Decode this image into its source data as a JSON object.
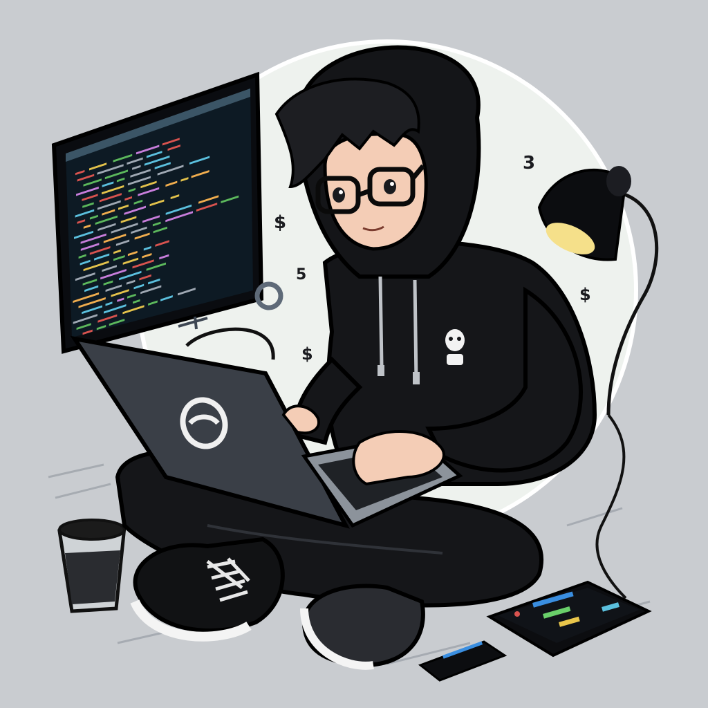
{
  "scene": {
    "subject": "developer-in-hoodie",
    "colors": {
      "background": "#c9ccd0",
      "halo": "#eef2ee",
      "hoodie": "#151619",
      "outline": "#08090b",
      "skin": "#f4cdb6",
      "monitor_screen": "#0d1a24",
      "laptop_body": "#3a3f47",
      "lamp_light": "#f5e08a",
      "coffee": "#1b1b1b"
    },
    "floating_symbols": [
      "$",
      "$",
      "$",
      "$",
      "3",
      "5"
    ],
    "code_colors": [
      "#e3c24b",
      "#d9534f",
      "#5cb85c",
      "#5bc0de",
      "#c77ddb",
      "#f0ad4e",
      "#9fa8b3"
    ]
  }
}
